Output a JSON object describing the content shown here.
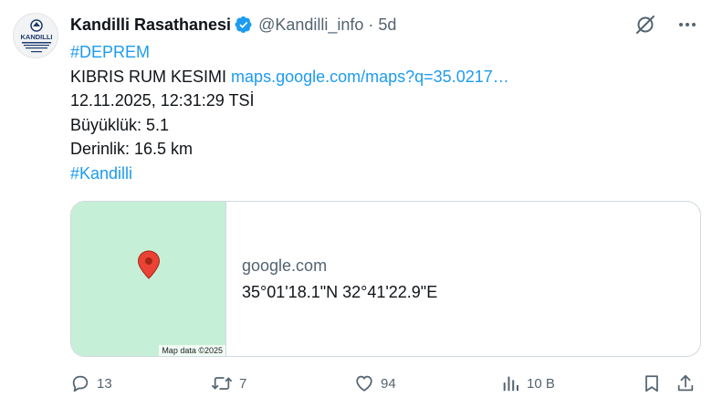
{
  "account": {
    "display_name": "Kandilli Rasathanesi",
    "handle": "@Kandilli_info",
    "separator": "·",
    "time": "5d",
    "avatar_text": "KANDILLI"
  },
  "tweet": {
    "hashtag_1": "#DEPREM",
    "region": "KIBRIS RUM KESIMI",
    "map_link": "maps.google.com/maps?q=35.0217…",
    "datetime": "12.11.2025, 12:31:29 TSİ",
    "magnitude": "Büyüklük: 5.1",
    "depth": "Derinlik: 16.5 km",
    "hashtag_2": "#Kandilli"
  },
  "card": {
    "map_credit": "Map data ©2025",
    "domain": "google.com",
    "title": "35°01'18.1\"N 32°41'22.9\"E"
  },
  "actions": {
    "replies": "13",
    "reposts": "7",
    "likes": "94",
    "views": "10 B"
  },
  "colors": {
    "accent": "#1d9bf0",
    "secondary_text": "#536471",
    "map_background": "#c6efd8",
    "pin": "#ea4335"
  },
  "icons": [
    "verified-badge-icon",
    "grok-icon",
    "more-icon",
    "map-pin-icon",
    "reply-icon",
    "repost-icon",
    "like-icon",
    "views-icon",
    "bookmark-icon",
    "share-icon"
  ]
}
